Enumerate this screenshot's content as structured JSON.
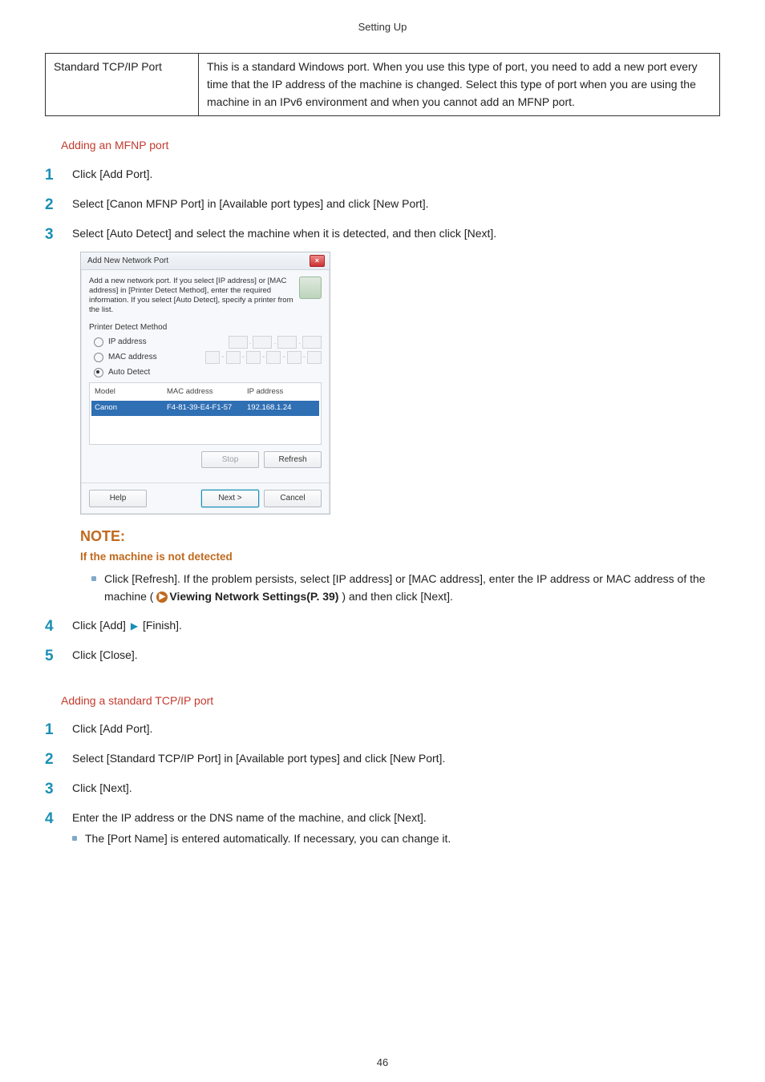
{
  "running_head": "Setting Up",
  "page_number": "46",
  "table": {
    "key": "Standard TCP/IP Port",
    "value": "This is a standard Windows port. When you use this type of port, you need to add a new port every time that the IP address of the machine is changed. Select this type of port when you are using the machine in an IPv6 environment and when you cannot add an MFNP port."
  },
  "section_a": {
    "title": "Adding an MFNP port",
    "steps": {
      "s1": "Click [Add Port].",
      "s2": "Select [Canon MFNP Port] in [Available port types] and click [New Port].",
      "s3": "Select [Auto Detect] and select the machine when it is detected, and then click [Next].",
      "s4a": "Click [Add]",
      "s4b": "[Finish].",
      "s5": "Click [Close]."
    }
  },
  "dialog": {
    "title": "Add New Network Port",
    "instruction": "Add a new network port. If you select [IP address] or [MAC address] in [Printer Detect Method], enter the required information. If you select [Auto Detect], specify a printer from the list.",
    "group": "Printer Detect Method",
    "radio_ip": "IP address",
    "radio_mac": "MAC address",
    "radio_auto": "Auto Detect",
    "col_model": "Model",
    "col_mac": "MAC address",
    "col_ip": "IP address",
    "row_model": "Canon",
    "row_mac": "F4-81-39-E4-F1-57",
    "row_ip": "192.168.1.24",
    "btn_stop": "Stop",
    "btn_refresh": "Refresh",
    "btn_help": "Help",
    "btn_next": "Next >",
    "btn_cancel": "Cancel"
  },
  "note": {
    "title": "NOTE:",
    "subtitle": "If the machine is not detected",
    "body_a": "Click [Refresh]. If the problem persists, select [IP address] or [MAC address], enter the IP address or MAC address of the machine ( ",
    "xref": "Viewing Network Settings(P. 39)",
    "body_b": " ) and then click [Next]."
  },
  "section_b": {
    "title": "Adding a standard TCP/IP port",
    "steps": {
      "s1": "Click [Add Port].",
      "s2": "Select [Standard TCP/IP Port] in [Available port types] and click [New Port].",
      "s3": "Click [Next].",
      "s4": "Enter the IP address or the DNS name of the machine, and click [Next].",
      "s4_note": "The [Port Name] is entered automatically. If necessary, you can change it."
    }
  }
}
